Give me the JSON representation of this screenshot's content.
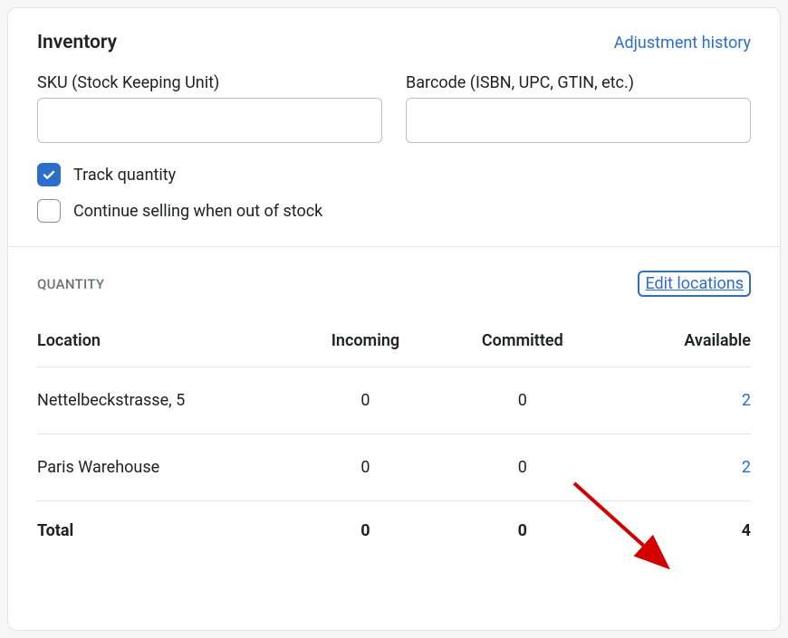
{
  "header": {
    "title": "Inventory",
    "history_link": "Adjustment history"
  },
  "sku": {
    "label": "SKU (Stock Keeping Unit)",
    "value": "",
    "placeholder": ""
  },
  "barcode": {
    "label": "Barcode (ISBN, UPC, GTIN, etc.)",
    "value": "",
    "placeholder": ""
  },
  "checks": {
    "track_qty": {
      "label": "Track quantity",
      "checked": true
    },
    "continue_selling": {
      "label": "Continue selling when out of stock",
      "checked": false
    }
  },
  "quantity": {
    "subhead": "QUANTITY",
    "edit_link": "Edit locations",
    "columns": {
      "location": "Location",
      "incoming": "Incoming",
      "committed": "Committed",
      "available": "Available"
    },
    "rows": [
      {
        "location": "Nettelbeckstrasse, 5",
        "incoming": "0",
        "committed": "0",
        "available": "2"
      },
      {
        "location": "Paris Warehouse",
        "incoming": "0",
        "committed": "0",
        "available": "2"
      }
    ],
    "total": {
      "label": "Total",
      "incoming": "0",
      "committed": "0",
      "available": "4"
    }
  }
}
